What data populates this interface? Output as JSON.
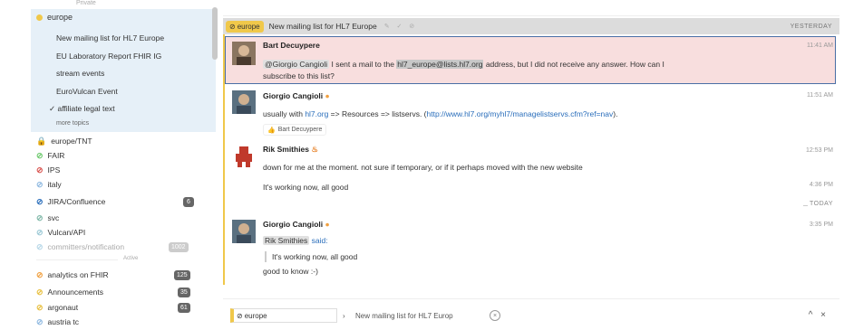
{
  "sidebar": {
    "top_faint": "Private",
    "stream": {
      "name": "europe",
      "color": "#f0c84a"
    },
    "topics": [
      "New mailing list for HL7 Europe",
      "EU Laboratory Report FHIR IG",
      "stream events",
      "EuroVulcan Event",
      "affiliate legal text"
    ],
    "active_topic_check": "✓",
    "more_topics": "more topics",
    "streams": [
      {
        "name": "europe/TNT",
        "icon": "lock-icon",
        "color": "#5bb85b",
        "faint": false
      },
      {
        "name": "FAIR",
        "icon": "hash-icon",
        "color": "#6cc96c",
        "faint": false
      },
      {
        "name": "IPS",
        "icon": "hash-icon",
        "color": "#d9534f",
        "faint": false
      },
      {
        "name": "italy",
        "icon": "hash-icon",
        "color": "#8fb9e0",
        "faint": false
      },
      {
        "name": "JIRA/Confluence",
        "icon": "hash-icon",
        "color": "#2a6ebb",
        "faint": false,
        "badge": "6"
      },
      {
        "name": "svc",
        "icon": "hash-icon",
        "color": "#7fb8a8",
        "faint": false
      },
      {
        "name": "Vulcan/API",
        "icon": "hash-icon",
        "color": "#9cc9d6",
        "faint": false
      },
      {
        "name": "committers/notification",
        "icon": "hash-icon",
        "color": "#b8d8e8",
        "faint": true,
        "badge": "1002"
      }
    ],
    "divider_label": "Active",
    "streams_below": [
      {
        "name": "analytics on FHIR",
        "icon": "hash-icon",
        "color": "#f0a040",
        "badge": "125"
      },
      {
        "name": "Announcements",
        "icon": "hash-icon",
        "color": "#e8c040",
        "badge": "35"
      },
      {
        "name": "argonaut",
        "icon": "hash-icon",
        "color": "#e8c040",
        "badge": "61"
      },
      {
        "name": "austria tc",
        "icon": "hash-icon",
        "color": "#8fb9e0"
      }
    ]
  },
  "header": {
    "stream_label": "europe",
    "topic": "New mailing list for HL7 Europe",
    "icons": "✎ ✓ ⊘",
    "date": "YESTERDAY"
  },
  "messages": [
    {
      "sender": "Bart Decuypere",
      "time": "11:41 AM",
      "mention": "@Giorgio Cangioli",
      "text_before": " I sent a mail to the ",
      "code": "hl7_europe@lists.hl7.org",
      "text_after": " address, but I did not receive any answer. How can I",
      "text_line2": "subscribe to this list?"
    },
    {
      "sender": "Giorgio Cangioli",
      "time": "11:51 AM",
      "text_before": "usually with ",
      "link1": "hl7.org",
      "text_mid": " => Resources => listservs. (",
      "link2": "http://www.hl7.org/myhl7/managelistservs.cfm?ref=nav",
      "text_end": ").",
      "reaction_user": "Bart Decuypere",
      "reaction_icon": "👍"
    },
    {
      "sender": "Rik Smithies",
      "time": "12:53 PM",
      "text": "down for me at the moment. not sure if temporary, or if it perhaps moved with the new website",
      "followup_time": "4:36 PM",
      "followup_text": "It's working now, all good"
    },
    {
      "sender": "Giorgio Cangioli",
      "time": "3:35 PM",
      "quote_user": "Rik Smithies",
      "quote_said": "said:",
      "quote_text": "It's working now, all good",
      "text": "good to know :-)"
    }
  ],
  "today_label": "TODAY",
  "compose": {
    "stream": "europe",
    "arrow": "›",
    "topic": "New mailing list for HL7 Europ",
    "clear": "×",
    "controls": "^ ×"
  }
}
